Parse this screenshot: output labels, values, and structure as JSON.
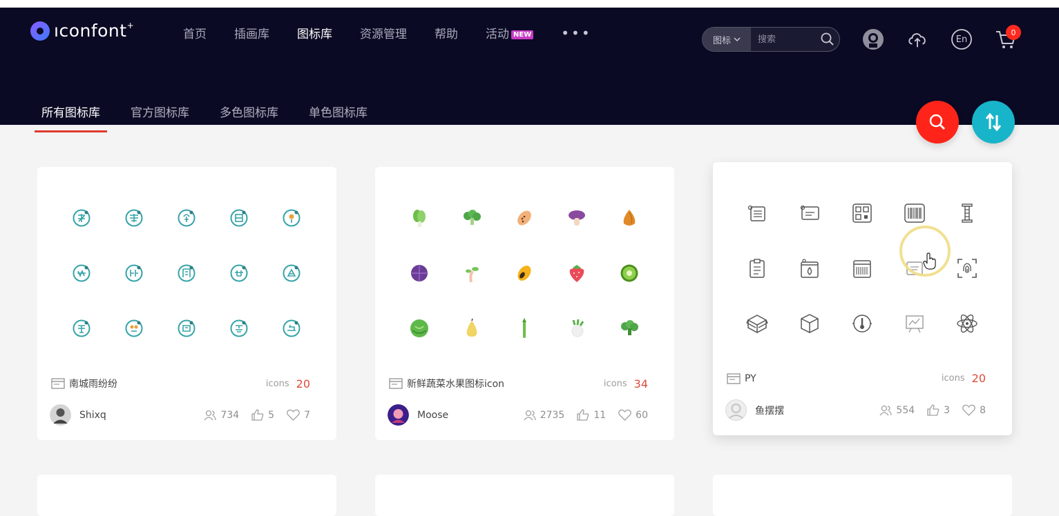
{
  "brand": {
    "name": "ıconfont",
    "plus": "+"
  },
  "nav": {
    "items": [
      "首页",
      "插画库",
      "图标库",
      "资源管理",
      "帮助",
      "活动"
    ],
    "badge": "NEW",
    "more": "•••"
  },
  "search": {
    "type": "图标",
    "placeholder": "搜索"
  },
  "cart": {
    "count": "0"
  },
  "lang": "En",
  "subnav": [
    "所有图标库",
    "官方图标库",
    "多色图标库",
    "单色图标库"
  ],
  "colors": {
    "header": "#0b0a24",
    "accent_red": "#ff2419",
    "accent_teal": "#18b4c9",
    "count_red": "#e04a3a"
  },
  "cards": [
    {
      "title": "南城雨纷纷",
      "icons_label": "icons",
      "icon_count": "20",
      "author": "Shixq",
      "users": "734",
      "likes": "5",
      "favorites": "7"
    },
    {
      "title": "新鲜蔬菜水果图标icon",
      "icons_label": "icons",
      "icon_count": "34",
      "author": "Moose",
      "users": "2735",
      "likes": "11",
      "favorites": "60"
    },
    {
      "title": "PY",
      "icons_label": "icons",
      "icon_count": "20",
      "author": "鱼摆摆",
      "users": "554",
      "likes": "3",
      "favorites": "8"
    }
  ]
}
